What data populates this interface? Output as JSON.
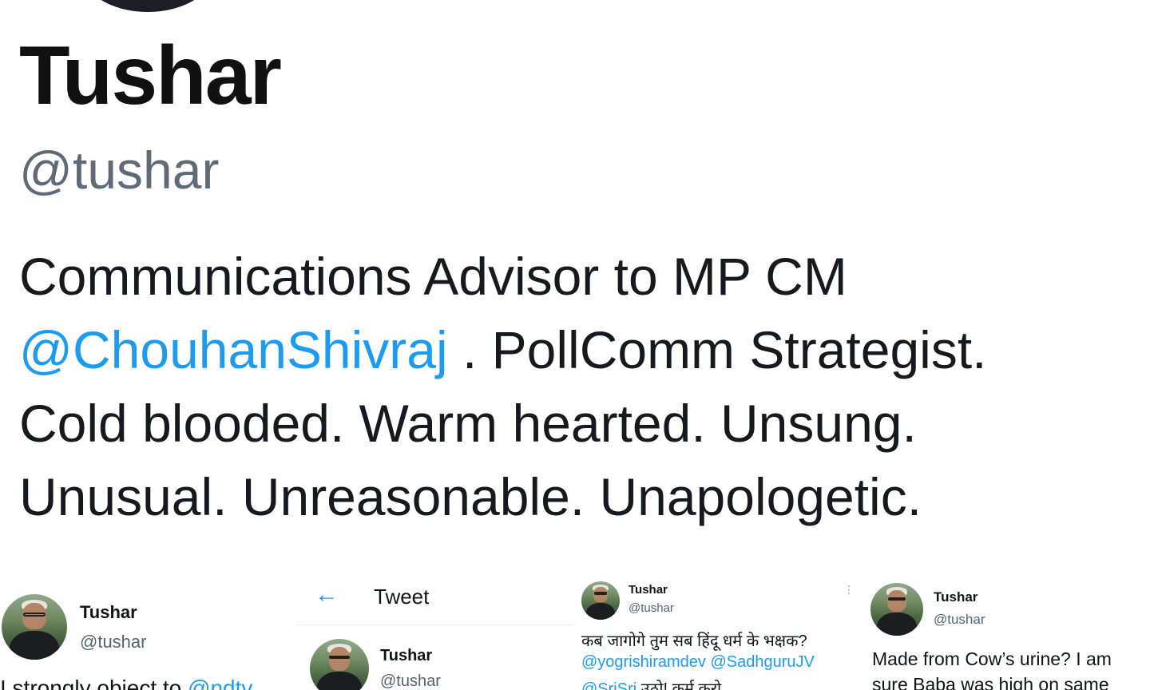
{
  "profile": {
    "name": "Tushar",
    "handle": "@tushar",
    "bio": {
      "line1": "Communications Advisor to MP CM",
      "mention": "@ChouhanShivraj",
      "line2_rest": " . PollComm Strategist.",
      "line3": "Cold blooded. Warm hearted. Unsung.",
      "line4": "Unusual. Unreasonable. Unapologetic."
    }
  },
  "tweets": [
    {
      "name": "Tushar",
      "handle": "@tushar",
      "text_start": "I strongly object to ",
      "mention": "@ndtv"
    },
    {
      "header_title": "Tweet",
      "back_icon": "arrow-left-icon",
      "name": "Tushar",
      "handle": "@tushar"
    },
    {
      "name": "Tushar",
      "handle": "@tushar",
      "line1": "कब जागोगे तुम सब हिंदू धर्म के भक्षक?",
      "mention1": "@yogrishiramdev",
      "mention2": "@SadhguruJV",
      "mention3": "@SriSri",
      "line3_rest": " उठो! कर्म करो",
      "more_icon": "more-vertical-icon"
    },
    {
      "name": "Tushar",
      "handle": "@tushar",
      "line1": "Made from Cow’s urine? I am",
      "line2": "sure Baba was high on same"
    }
  ],
  "colors": {
    "link": "#1d9bf0",
    "handle_gray": "#536471",
    "text": "#0f1419"
  }
}
